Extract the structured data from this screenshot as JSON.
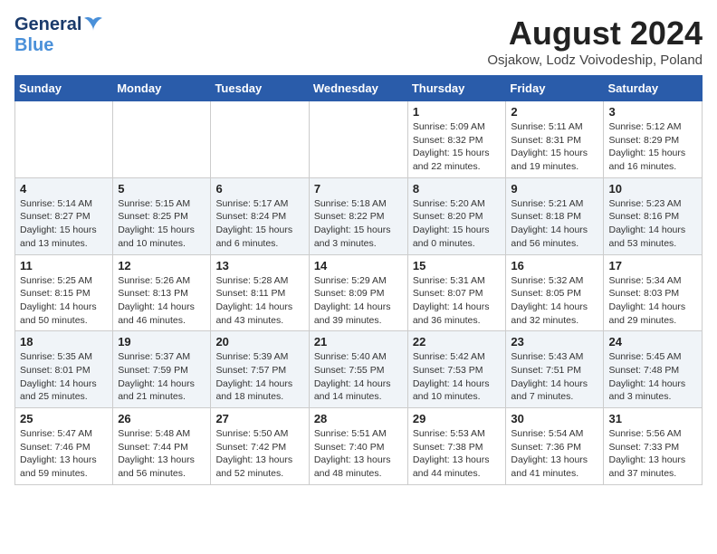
{
  "header": {
    "logo_general": "General",
    "logo_blue": "Blue",
    "month_year": "August 2024",
    "location": "Osjakow, Lodz Voivodeship, Poland"
  },
  "days_of_week": [
    "Sunday",
    "Monday",
    "Tuesday",
    "Wednesday",
    "Thursday",
    "Friday",
    "Saturday"
  ],
  "weeks": [
    [
      {
        "day": "",
        "info": ""
      },
      {
        "day": "",
        "info": ""
      },
      {
        "day": "",
        "info": ""
      },
      {
        "day": "",
        "info": ""
      },
      {
        "day": "1",
        "info": "Sunrise: 5:09 AM\nSunset: 8:32 PM\nDaylight: 15 hours\nand 22 minutes."
      },
      {
        "day": "2",
        "info": "Sunrise: 5:11 AM\nSunset: 8:31 PM\nDaylight: 15 hours\nand 19 minutes."
      },
      {
        "day": "3",
        "info": "Sunrise: 5:12 AM\nSunset: 8:29 PM\nDaylight: 15 hours\nand 16 minutes."
      }
    ],
    [
      {
        "day": "4",
        "info": "Sunrise: 5:14 AM\nSunset: 8:27 PM\nDaylight: 15 hours\nand 13 minutes."
      },
      {
        "day": "5",
        "info": "Sunrise: 5:15 AM\nSunset: 8:25 PM\nDaylight: 15 hours\nand 10 minutes."
      },
      {
        "day": "6",
        "info": "Sunrise: 5:17 AM\nSunset: 8:24 PM\nDaylight: 15 hours\nand 6 minutes."
      },
      {
        "day": "7",
        "info": "Sunrise: 5:18 AM\nSunset: 8:22 PM\nDaylight: 15 hours\nand 3 minutes."
      },
      {
        "day": "8",
        "info": "Sunrise: 5:20 AM\nSunset: 8:20 PM\nDaylight: 15 hours\nand 0 minutes."
      },
      {
        "day": "9",
        "info": "Sunrise: 5:21 AM\nSunset: 8:18 PM\nDaylight: 14 hours\nand 56 minutes."
      },
      {
        "day": "10",
        "info": "Sunrise: 5:23 AM\nSunset: 8:16 PM\nDaylight: 14 hours\nand 53 minutes."
      }
    ],
    [
      {
        "day": "11",
        "info": "Sunrise: 5:25 AM\nSunset: 8:15 PM\nDaylight: 14 hours\nand 50 minutes."
      },
      {
        "day": "12",
        "info": "Sunrise: 5:26 AM\nSunset: 8:13 PM\nDaylight: 14 hours\nand 46 minutes."
      },
      {
        "day": "13",
        "info": "Sunrise: 5:28 AM\nSunset: 8:11 PM\nDaylight: 14 hours\nand 43 minutes."
      },
      {
        "day": "14",
        "info": "Sunrise: 5:29 AM\nSunset: 8:09 PM\nDaylight: 14 hours\nand 39 minutes."
      },
      {
        "day": "15",
        "info": "Sunrise: 5:31 AM\nSunset: 8:07 PM\nDaylight: 14 hours\nand 36 minutes."
      },
      {
        "day": "16",
        "info": "Sunrise: 5:32 AM\nSunset: 8:05 PM\nDaylight: 14 hours\nand 32 minutes."
      },
      {
        "day": "17",
        "info": "Sunrise: 5:34 AM\nSunset: 8:03 PM\nDaylight: 14 hours\nand 29 minutes."
      }
    ],
    [
      {
        "day": "18",
        "info": "Sunrise: 5:35 AM\nSunset: 8:01 PM\nDaylight: 14 hours\nand 25 minutes."
      },
      {
        "day": "19",
        "info": "Sunrise: 5:37 AM\nSunset: 7:59 PM\nDaylight: 14 hours\nand 21 minutes."
      },
      {
        "day": "20",
        "info": "Sunrise: 5:39 AM\nSunset: 7:57 PM\nDaylight: 14 hours\nand 18 minutes."
      },
      {
        "day": "21",
        "info": "Sunrise: 5:40 AM\nSunset: 7:55 PM\nDaylight: 14 hours\nand 14 minutes."
      },
      {
        "day": "22",
        "info": "Sunrise: 5:42 AM\nSunset: 7:53 PM\nDaylight: 14 hours\nand 10 minutes."
      },
      {
        "day": "23",
        "info": "Sunrise: 5:43 AM\nSunset: 7:51 PM\nDaylight: 14 hours\nand 7 minutes."
      },
      {
        "day": "24",
        "info": "Sunrise: 5:45 AM\nSunset: 7:48 PM\nDaylight: 14 hours\nand 3 minutes."
      }
    ],
    [
      {
        "day": "25",
        "info": "Sunrise: 5:47 AM\nSunset: 7:46 PM\nDaylight: 13 hours\nand 59 minutes."
      },
      {
        "day": "26",
        "info": "Sunrise: 5:48 AM\nSunset: 7:44 PM\nDaylight: 13 hours\nand 56 minutes."
      },
      {
        "day": "27",
        "info": "Sunrise: 5:50 AM\nSunset: 7:42 PM\nDaylight: 13 hours\nand 52 minutes."
      },
      {
        "day": "28",
        "info": "Sunrise: 5:51 AM\nSunset: 7:40 PM\nDaylight: 13 hours\nand 48 minutes."
      },
      {
        "day": "29",
        "info": "Sunrise: 5:53 AM\nSunset: 7:38 PM\nDaylight: 13 hours\nand 44 minutes."
      },
      {
        "day": "30",
        "info": "Sunrise: 5:54 AM\nSunset: 7:36 PM\nDaylight: 13 hours\nand 41 minutes."
      },
      {
        "day": "31",
        "info": "Sunrise: 5:56 AM\nSunset: 7:33 PM\nDaylight: 13 hours\nand 37 minutes."
      }
    ]
  ]
}
